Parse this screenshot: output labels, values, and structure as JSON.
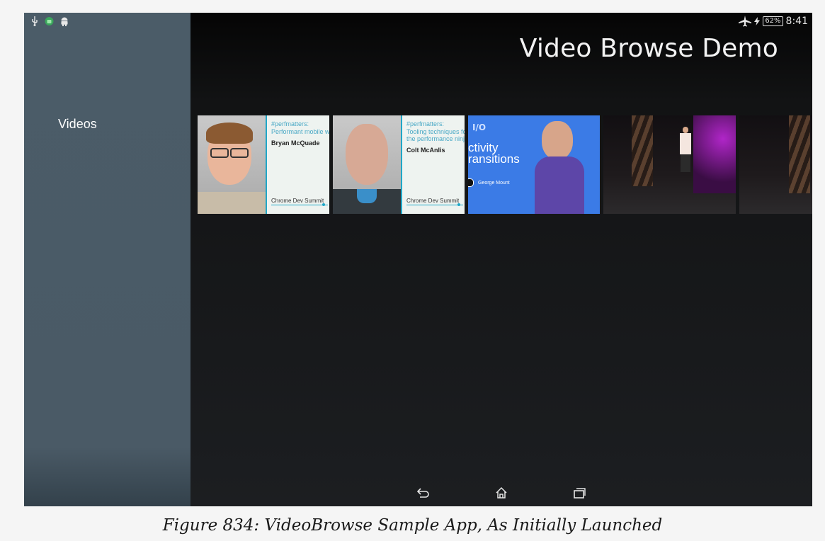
{
  "status_bar": {
    "left_icons": [
      "usb-icon",
      "android-robot-green-icon",
      "android-icon"
    ],
    "right_icons": [
      "airplane-mode-icon",
      "charging-icon"
    ],
    "battery": "62%",
    "time": "8:41"
  },
  "sidebar": {
    "header": "Videos"
  },
  "app": {
    "title": "Video Browse Demo"
  },
  "videos": [
    {
      "hashtag": "#perfmatters:",
      "subtitle": "Performant mobile we",
      "speaker": "Bryan McQuade",
      "event": "Chrome Dev Summit"
    },
    {
      "hashtag": "#perfmatters:",
      "subtitle": "Tooling techniques for",
      "subtitle2": "the performance ninja",
      "speaker": "Colt McAnlis",
      "event": "Chrome Dev Summit"
    },
    {
      "badge": "I/O",
      "line1": "ctivity",
      "line2": "ransitions",
      "presenter": "George Mount"
    },
    {
      "scene": "stage-presenter"
    },
    {
      "scene": "stage-presenter-partial"
    }
  ],
  "nav": {
    "buttons": [
      "back-icon",
      "home-icon",
      "recents-icon"
    ]
  },
  "caption": "Figure 834: VideoBrowse Sample App, As Initially Launched",
  "colors": {
    "sidebar": "#4a5a66",
    "background": "#1c1e21",
    "accent": "#1fa7c7",
    "io_blue": "#3b7be6"
  }
}
